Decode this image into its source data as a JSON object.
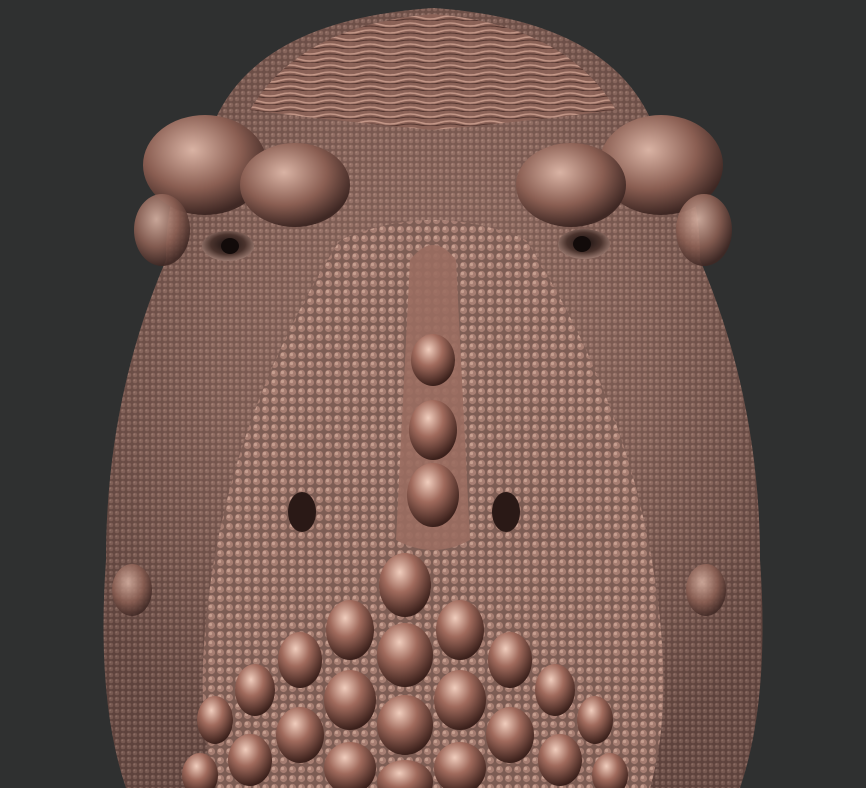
{
  "scene": {
    "subject": "sculpted-dinosaur-head",
    "view": "front",
    "background_color": "#2f3030",
    "material_colors": {
      "base": "#8a6a60",
      "highlight": "#e0bdb0",
      "shadow": "#3b2520",
      "warm_mid": "#a7786a"
    },
    "icons": [
      "dinosaur-head-render"
    ]
  }
}
